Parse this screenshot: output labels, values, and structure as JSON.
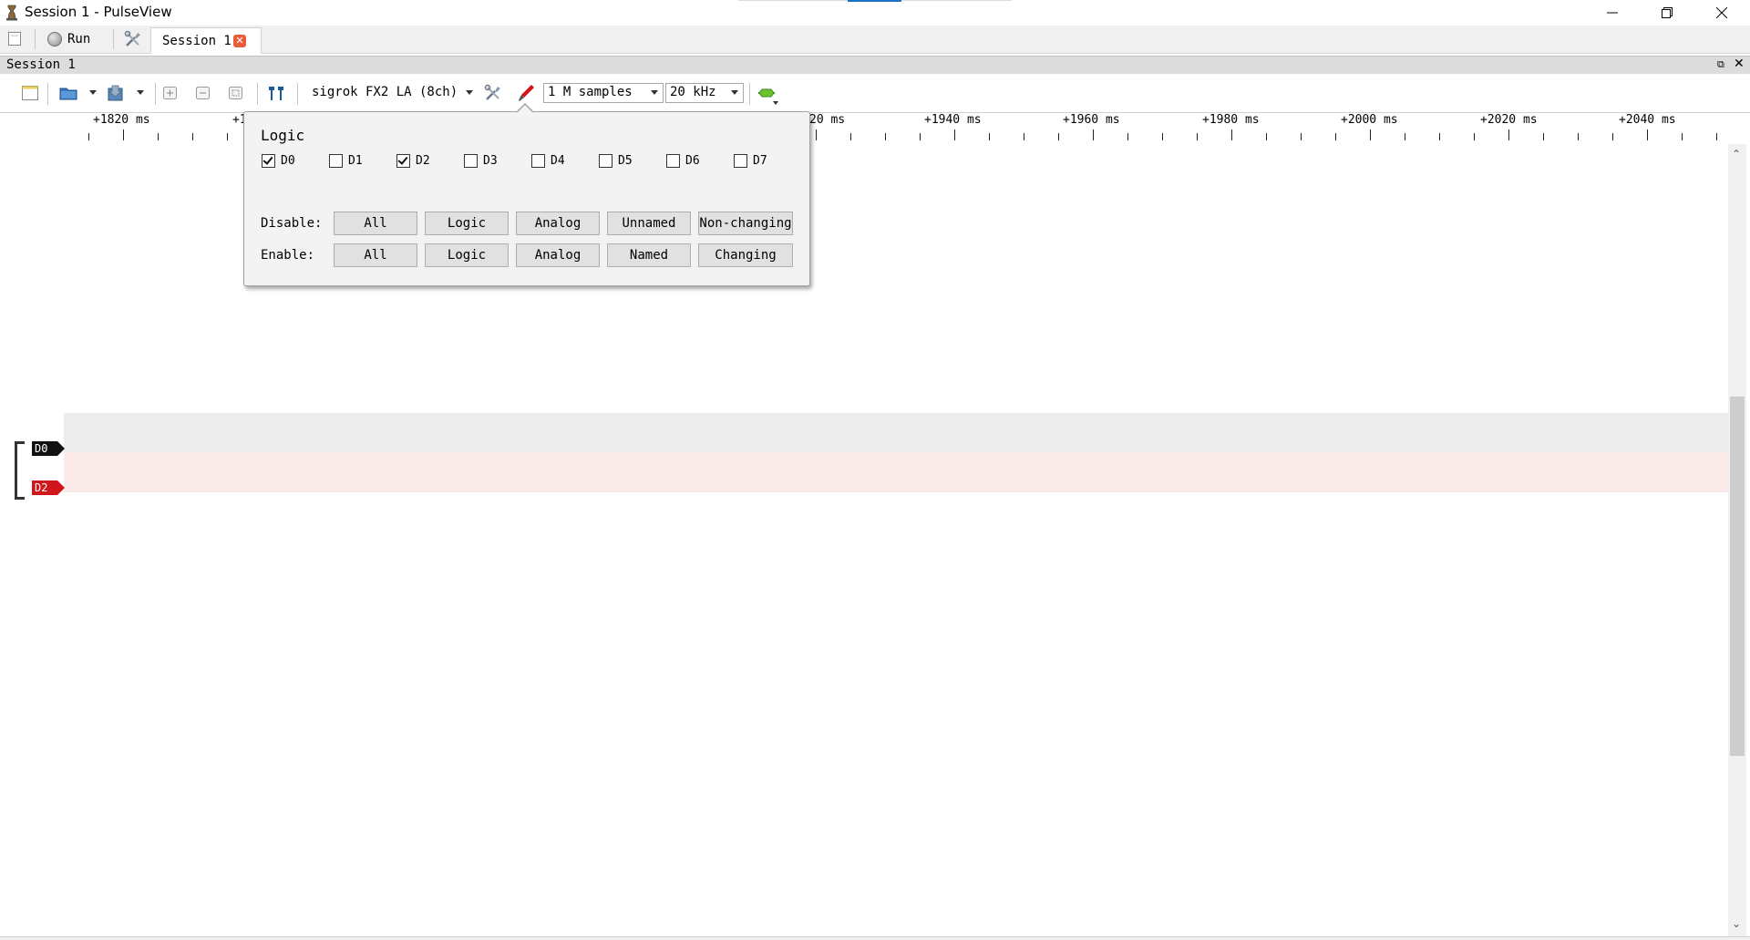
{
  "window": {
    "title": "Session 1 - PulseView"
  },
  "tabbar": {
    "run_label": "Run",
    "session_tab": "Session 1"
  },
  "dock": {
    "title": "Session 1"
  },
  "toolbar": {
    "device": "sigrok FX2 LA (8ch)",
    "samples": "1 M samples",
    "samplerate": "20 kHz"
  },
  "ruler": {
    "labels": [
      "+1820 ms",
      "+1",
      "20 ms",
      "+1940 ms",
      "+1960 ms",
      "+1980 ms",
      "+2000 ms",
      "+2020 ms",
      "+2040 ms"
    ]
  },
  "channels": {
    "d0": {
      "name": "D0",
      "color": "#111111"
    },
    "d2": {
      "name": "D2",
      "color": "#d0161a"
    }
  },
  "popup": {
    "title": "Logic",
    "checkboxes": [
      {
        "label": "D0",
        "checked": true
      },
      {
        "label": "D1",
        "checked": false
      },
      {
        "label": "D2",
        "checked": true
      },
      {
        "label": "D3",
        "checked": false
      },
      {
        "label": "D4",
        "checked": false
      },
      {
        "label": "D5",
        "checked": false
      },
      {
        "label": "D6",
        "checked": false
      },
      {
        "label": "D7",
        "checked": false
      }
    ],
    "disable_label": "Disable:",
    "enable_label": "Enable:",
    "disable_buttons": [
      "All",
      "Logic",
      "Analog",
      "Unnamed",
      "Non-changing"
    ],
    "enable_buttons": [
      "All",
      "Logic",
      "Analog",
      "Named",
      "Changing"
    ]
  }
}
